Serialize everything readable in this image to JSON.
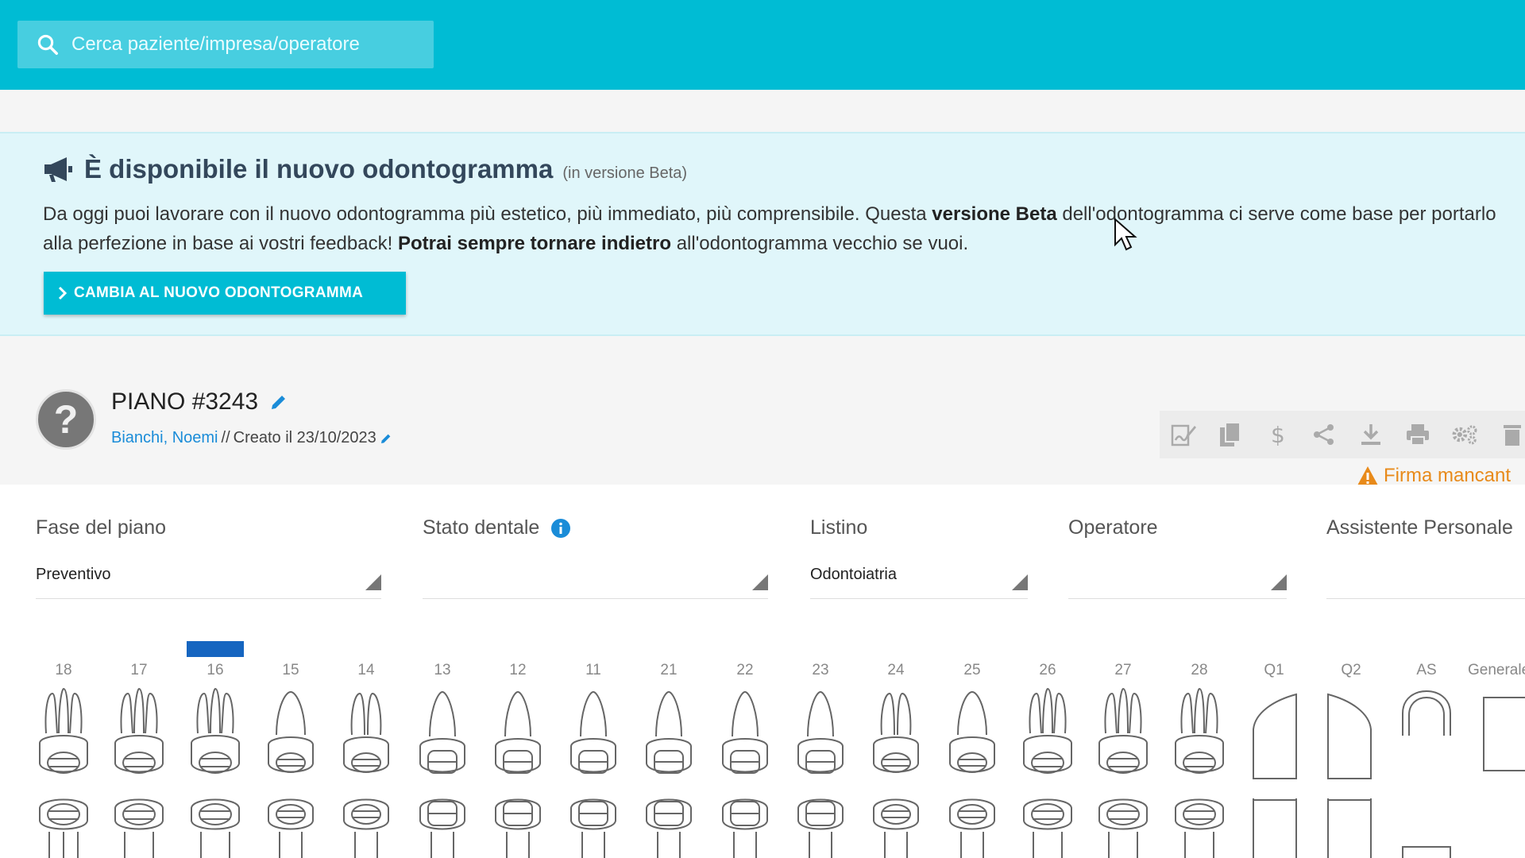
{
  "search": {
    "placeholder": "Cerca paziente/impresa/operatore",
    "icon": "search-icon"
  },
  "banner": {
    "title": "È disponibile il nuovo odontogramma",
    "beta_note": "(in versione Beta)",
    "text_1": "Da oggi puoi lavorare con il nuovo odontogramma più estetico, più immediato, più comprensibile. Questa ",
    "text_bold_1": "versione Beta",
    "text_2": " dell'odontogramma ci serve come base per portarlo alla perfezione in base ai vostri feedback! ",
    "text_bold_2": "Potrai sempre tornare indietro",
    "text_3": " all'odontogramma vecchio se vuoi.",
    "button_label": "CAMBIA AL NUOVO ODONTOGRAMMA"
  },
  "plan": {
    "title": "PIANO #3243",
    "patient": "Bianchi, Noemi",
    "separator": "//",
    "created": "Creato il 23/10/2023",
    "avatar_glyph": "?",
    "warning": "Firma mancant",
    "toolbar_icons": [
      "sign-icon",
      "copy-icon",
      "dollar-icon",
      "share-icon",
      "download-icon",
      "print-icon",
      "settings-icon",
      "trash-icon"
    ]
  },
  "form": {
    "fase": {
      "label": "Fase del piano",
      "value": "Preventivo"
    },
    "stato": {
      "label": "Stato dentale",
      "value": ""
    },
    "listino": {
      "label": "Listino",
      "value": "Odontoiatria"
    },
    "operatore": {
      "label": "Operatore",
      "value": ""
    },
    "assistente": {
      "label": "Assistente Personale",
      "value": ""
    }
  },
  "teeth": {
    "numbers": [
      "18",
      "17",
      "16",
      "15",
      "14",
      "13",
      "12",
      "11",
      "21",
      "22",
      "23",
      "24",
      "25",
      "26",
      "27",
      "28",
      "Q1",
      "Q2",
      "AS",
      "Generale"
    ],
    "selected": "16"
  },
  "colors": {
    "header": "#00bcd4",
    "banner_bg": "#e0f6fa",
    "link": "#1a8cd8",
    "warning": "#e88a1a",
    "selected": "#1565c0"
  }
}
